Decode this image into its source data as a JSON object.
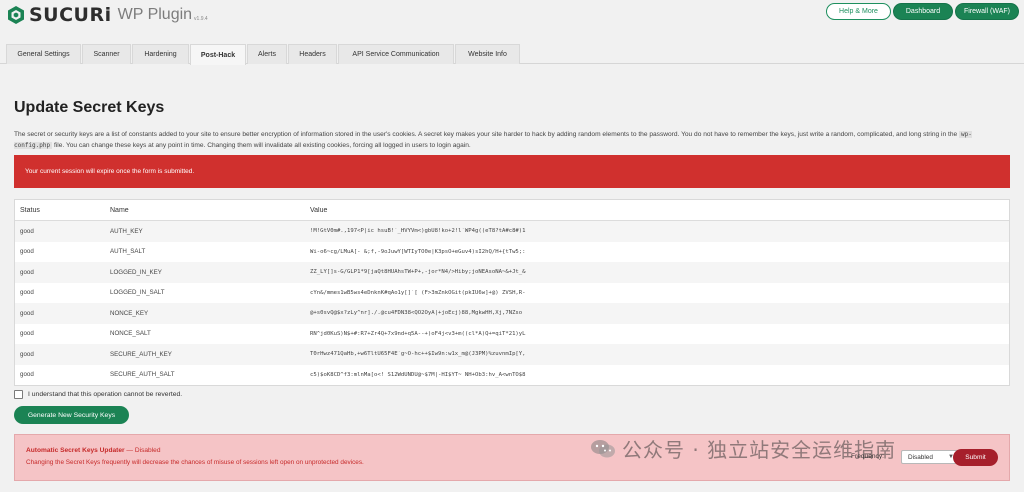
{
  "header": {
    "brand": "SUCURi",
    "product": "WP Plugin",
    "version": "v1.9.4",
    "buttons": {
      "help": "Help & More",
      "dashboard": "Dashboard",
      "firewall": "Firewall (WAF)"
    },
    "colors": {
      "accent_green": "#1b8354",
      "danger_red": "#d0302e"
    }
  },
  "tabs": [
    {
      "label": "General Settings"
    },
    {
      "label": "Scanner"
    },
    {
      "label": "Hardening"
    },
    {
      "label": "Post-Hack",
      "active": true
    },
    {
      "label": "Alerts"
    },
    {
      "label": "Headers"
    },
    {
      "label": "API Service Communication"
    },
    {
      "label": "Website Info"
    }
  ],
  "main": {
    "title": "Update Secret Keys",
    "desc_part1": "The secret or security keys are a list of constants added to your site to ensure better encryption of information stored in the user's cookies. A secret key makes your site harder to hack by adding random elements to the password. You do not have to remember the keys, just write a random, complicated, and long string in the",
    "desc_code": "wp-config.php",
    "desc_part2": "file. You can change these keys at any point in time. Changing them will invalidate all existing cookies, forcing all logged in users to login again.",
    "session_alert": "Your current session will expire once the form is submitted.",
    "table": {
      "headers": {
        "status": "Status",
        "name": "Name",
        "value": "Value"
      },
      "rows": [
        {
          "status": "good",
          "name": "AUTH_KEY",
          "value": "!M!GtV0m#.,197<P|ic hsuB!`_HVYVm<)gbU8!ko+2!l`WP4g((eT8?tA#c8#)1"
        },
        {
          "status": "good",
          "name": "AUTH_SALT",
          "value": "Wi-o6~cg/LMuA[- &;f,-9oJuwY[WTIyTO0e|K3psO+eGuv4)sI2hQ/H+{tTw5;:"
        },
        {
          "status": "good",
          "name": "LOGGED_IN_KEY",
          "value": "ZZ_LY[]s-G/GLP1*9[jaQt8HUAhsTW+P+,-jor*N4/>Hiby;joNEAsoNA~&+Jt_&"
        },
        {
          "status": "good",
          "name": "LOGGED_IN_SALT",
          "value": "cYn&/mmes1wB5ws4eDnknK#qAo1y[]`[ (F>3mZnkOGit(pkIU6w]+@) ZVSH,R-"
        },
        {
          "status": "good",
          "name": "NONCE_KEY",
          "value": "@+s0svQ@$x?zLy^nr]./.@cu4FDN38<QO2OyA|+joEcj)88,MgkwHH,Xj,7NZso"
        },
        {
          "status": "good",
          "name": "NONCE_SALT",
          "value": "RN^jd0KuS)N$+#:R7+Zr4Q+7x9nd+q5A--+)oF4j<v3+m((cl*A)Q+=qiT*21)yL"
        },
        {
          "status": "good",
          "name": "SECURE_AUTH_KEY",
          "value": "T0rHwz471QaHb,+w6TltU65F4E`g~O-hc++$Iw9n:w1x_m@(J3PM)%zuvnmIp[Y,"
        },
        {
          "status": "good",
          "name": "SECURE_AUTH_SALT",
          "value": "c5)$oK8CD^f3:mlnMa[o<! S12WdUNDU@~$7M|-HI$YT~ NH+Ob3:hv_A<wnTO$8"
        }
      ]
    },
    "confirm_label": "I understand that this operation cannot be reverted.",
    "generate_button": "Generate New Security Keys"
  },
  "auto_updater": {
    "title": "Automatic Secret Keys Updater",
    "status": "— Disabled",
    "desc": "Changing the Secret Keys frequently will decrease the chances of misuse of sessions left open on unprotected devices.",
    "frequency_label": "Frequency:",
    "frequency_value": "Disabled",
    "submit": "Submit"
  },
  "watermark": {
    "text": "公众号 · 独立站安全运维指南"
  }
}
